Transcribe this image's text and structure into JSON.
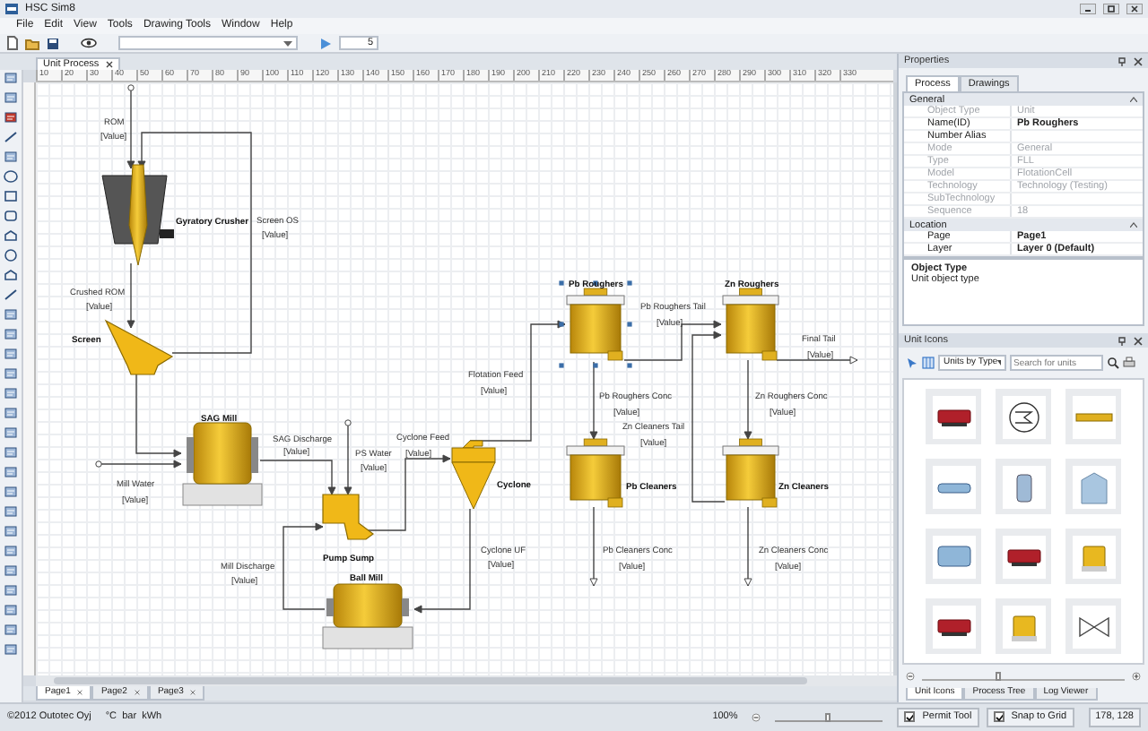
{
  "window": {
    "title": "HSC Sim8"
  },
  "menu": [
    "File",
    "Edit",
    "View",
    "Tools",
    "Drawing Tools",
    "Window",
    "Help"
  ],
  "toolbar": {
    "spin_value": "5"
  },
  "document_tabs": [
    {
      "label": "Unit Process",
      "selected": true
    }
  ],
  "ruler": [
    "10",
    "20",
    "30",
    "40",
    "50",
    "60",
    "70",
    "80",
    "90",
    "100",
    "110",
    "120",
    "130",
    "140",
    "150",
    "160",
    "170",
    "180",
    "190",
    "200",
    "210",
    "220",
    "230",
    "240",
    "250",
    "260",
    "270",
    "280",
    "290",
    "300",
    "310",
    "320",
    "330"
  ],
  "diagram": {
    "units": [
      {
        "name": "Gyratory Crusher",
        "kind": "crusher",
        "selected": false
      },
      {
        "name": "Screen",
        "kind": "screen",
        "selected": false
      },
      {
        "name": "SAG Mill",
        "kind": "sag_mill",
        "selected": false
      },
      {
        "name": "Pump Sump",
        "kind": "pump_sump",
        "selected": false
      },
      {
        "name": "Cyclone",
        "kind": "cyclone",
        "selected": false
      },
      {
        "name": "Ball Mill",
        "kind": "ball_mill",
        "selected": false
      },
      {
        "name": "Pb Roughers",
        "kind": "flotation_cell",
        "selected": true
      },
      {
        "name": "Zn Roughers",
        "kind": "flotation_cell",
        "selected": false
      },
      {
        "name": "Pb Cleaners",
        "kind": "flotation_cell",
        "selected": false
      },
      {
        "name": "Zn Cleaners",
        "kind": "flotation_cell",
        "selected": false
      }
    ],
    "streams": [
      {
        "name": "ROM",
        "value": "[Value]"
      },
      {
        "name": "Screen OS",
        "value": "[Value]"
      },
      {
        "name": "Crushed ROM",
        "value": "[Value]"
      },
      {
        "name": "Mill Water",
        "value": "[Value]"
      },
      {
        "name": "SAG Discharge",
        "value": "[Value]"
      },
      {
        "name": "PS Water",
        "value": "[Value]"
      },
      {
        "name": "Cyclone Feed",
        "value": "[Value]"
      },
      {
        "name": "Flotation Feed",
        "value": "[Value]"
      },
      {
        "name": "Mill Discharge",
        "value": "[Value]"
      },
      {
        "name": "Cyclone UF",
        "value": "[Value]"
      },
      {
        "name": "Pb Roughers Tail",
        "value": "[Value]"
      },
      {
        "name": "Pb Roughers Conc",
        "value": "[Value]"
      },
      {
        "name": "Final Tail",
        "value": "[Value]"
      },
      {
        "name": "Zn Roughers Conc",
        "value": "[Value]"
      },
      {
        "name": "Zn Cleaners Tail",
        "value": "[Value]"
      },
      {
        "name": "Pb Cleaners Conc",
        "value": "[Value]"
      },
      {
        "name": "Zn Cleaners Conc",
        "value": "[Value]"
      }
    ]
  },
  "page_tabs": [
    {
      "label": "Page1",
      "selected": true
    },
    {
      "label": "Page2",
      "selected": false
    },
    {
      "label": "Page3",
      "selected": false
    }
  ],
  "properties": {
    "title": "Properties",
    "tabs": [
      {
        "label": "Process",
        "selected": true
      },
      {
        "label": "Drawings",
        "selected": false
      }
    ],
    "groups": [
      {
        "name": "General",
        "rows": [
          {
            "label": "Object Type",
            "value": "Unit",
            "disabled": true,
            "emphasized": false
          },
          {
            "label": "Name(ID)",
            "value": "Pb Roughers",
            "disabled": false,
            "emphasized": true
          },
          {
            "label": "Number Alias",
            "disabled": false
          },
          {
            "label": "Mode",
            "value": "General",
            "disabled": true,
            "emphasized": false
          },
          {
            "label": "Type",
            "value": "FLL",
            "disabled": true,
            "emphasized": false
          },
          {
            "label": "Model",
            "value": "FlotationCell",
            "disabled": true,
            "emphasized": false
          },
          {
            "label": "Technology",
            "value": "Technology (Testing)",
            "disabled": true,
            "emphasized": false
          },
          {
            "label": "SubTechnology",
            "disabled": true
          },
          {
            "label": "Sequence",
            "value": "18",
            "disabled": true,
            "emphasized": false
          }
        ]
      },
      {
        "name": "Location",
        "rows": [
          {
            "label": "Page",
            "value": "Page1",
            "disabled": false,
            "emphasized": true
          },
          {
            "label": "Layer",
            "value": "Layer 0 (Default)",
            "disabled": false,
            "emphasized": true
          }
        ]
      }
    ],
    "description_title": "Object Type",
    "description": "Unit object type"
  },
  "unit_icons": {
    "title": "Unit Icons",
    "filter": "Units by Type",
    "icon_size": {
      "level": 0.38
    },
    "search": {
      "placeholder": "Search for units"
    },
    "tabs": [
      {
        "label": "Unit Icons",
        "selected": true
      },
      {
        "label": "Process Tree",
        "selected": false
      },
      {
        "label": "Log Viewer",
        "selected": false
      }
    ]
  },
  "status_bar": {
    "copyright": "©2012 Outotec Oyj",
    "units": "°C  bar  kWh",
    "zoom": "100%",
    "zoom_slider": {
      "level": 0.5
    },
    "toggles": [
      {
        "label": "Permit Tool",
        "checked": true
      },
      {
        "label": "Snap to Grid",
        "checked": true
      }
    ],
    "coordinates": "178, 128"
  }
}
